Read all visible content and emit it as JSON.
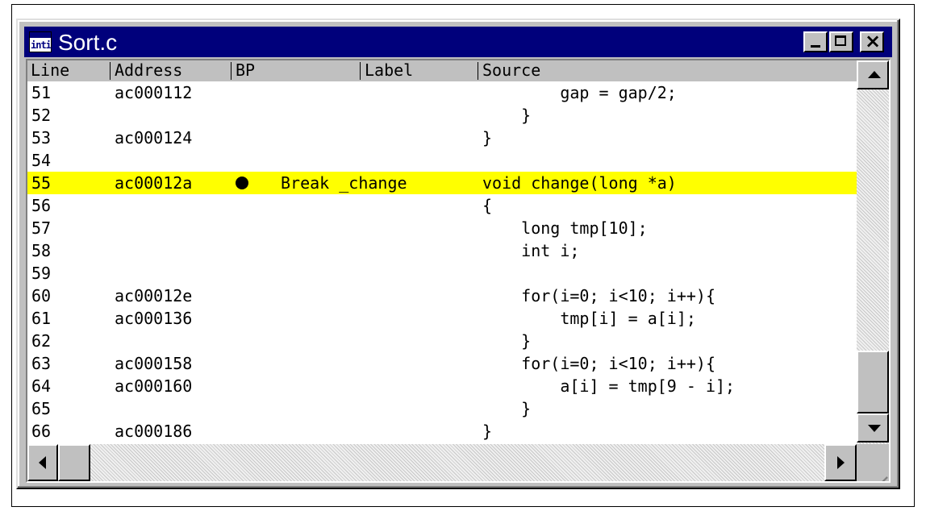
{
  "window": {
    "title": "Sort.c",
    "icon": "inti-app-icon",
    "icon_text": "inti;",
    "controls": {
      "minimize": "minimize-icon",
      "maximize": "maximize-icon",
      "close_label": "×"
    }
  },
  "columns": [
    "Line",
    "Address",
    "BP",
    "Label",
    "Source"
  ],
  "rows": [
    {
      "line": "51",
      "address": "ac000112",
      "bp": "",
      "label": "",
      "source": "        gap = gap/2;"
    },
    {
      "line": "52",
      "address": "",
      "bp": "",
      "label": "",
      "source": "    }"
    },
    {
      "line": "53",
      "address": "ac000124",
      "bp": "",
      "label": "",
      "source": "}"
    },
    {
      "line": "54",
      "address": "",
      "bp": "",
      "label": "",
      "source": ""
    },
    {
      "line": "55",
      "address": "ac00012a",
      "bp": "breakpoint-dot",
      "label": "Break _change",
      "source": "void change(long *a)",
      "highlighted": true
    },
    {
      "line": "56",
      "address": "",
      "bp": "",
      "label": "",
      "source": "{"
    },
    {
      "line": "57",
      "address": "",
      "bp": "",
      "label": "",
      "source": "    long tmp[10];"
    },
    {
      "line": "58",
      "address": "",
      "bp": "",
      "label": "",
      "source": "    int i;"
    },
    {
      "line": "59",
      "address": "",
      "bp": "",
      "label": "",
      "source": ""
    },
    {
      "line": "60",
      "address": "ac00012e",
      "bp": "",
      "label": "",
      "source": "    for(i=0; i<10; i++){"
    },
    {
      "line": "61",
      "address": "ac000136",
      "bp": "",
      "label": "",
      "source": "        tmp[i] = a[i];"
    },
    {
      "line": "62",
      "address": "",
      "bp": "",
      "label": "",
      "source": "    }"
    },
    {
      "line": "63",
      "address": "ac000158",
      "bp": "",
      "label": "",
      "source": "    for(i=0; i<10; i++){"
    },
    {
      "line": "64",
      "address": "ac000160",
      "bp": "",
      "label": "",
      "source": "        a[i] = tmp[9 - i];"
    },
    {
      "line": "65",
      "address": "",
      "bp": "",
      "label": "",
      "source": "    }"
    },
    {
      "line": "66",
      "address": "ac000186",
      "bp": "",
      "label": "",
      "source": "}"
    }
  ],
  "colors": {
    "titlebar": "#00007b",
    "highlight": "#ffff00",
    "face": "#c0c0c0"
  }
}
